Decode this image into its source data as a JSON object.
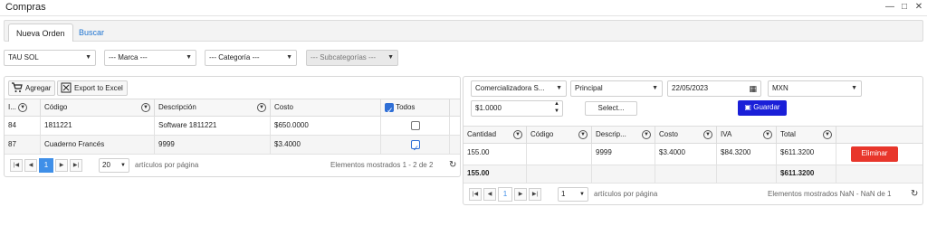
{
  "window": {
    "title": "Compras"
  },
  "tabs": [
    {
      "label": "Nueva Orden",
      "active": true
    },
    {
      "label": "Buscar",
      "active": false
    }
  ],
  "filters": {
    "proveedor": "TAU SOL",
    "marca": "--- Marca ---",
    "categoria": "--- Categoría ---",
    "subcategoria": "--- Subcategorías ---"
  },
  "products_grid": {
    "toolbar": {
      "add_label": "Agregar",
      "export_label": "Export to Excel"
    },
    "columns": [
      "I...",
      "Código",
      "Descripción",
      "Costo",
      "Todos"
    ],
    "rows": [
      {
        "id": "84",
        "codigo": "1811221",
        "descripcion": "Software 1811221",
        "costo": "$650.0000",
        "checked": false
      },
      {
        "id": "87",
        "codigo": "Cuaderno Francés",
        "descripcion": "9999",
        "costo": "$3.4000",
        "checked": true
      }
    ],
    "pager": {
      "page": "1",
      "page_size": "20",
      "page_size_label": "artículos por página",
      "info": "Elementos mostrados 1 - 2 de 2"
    }
  },
  "order": {
    "supplier": "Comercializadora S...",
    "warehouse": "Principal",
    "date": "22/05/2023",
    "currency": "MXN",
    "exchange_rate": "$1.0000",
    "select_label": "Select...",
    "save_label": "Guardar",
    "columns": [
      "Cantidad",
      "Código",
      "Descrip...",
      "Costo",
      "IVA",
      "Total"
    ],
    "rows": [
      {
        "cantidad": "155.00",
        "codigo": "",
        "descripcion": "9999",
        "costo": "$3.4000",
        "iva": "$84.3200",
        "total": "$611.3200",
        "delete_label": "Eliminar"
      }
    ],
    "totals": {
      "cantidad": "155.00",
      "total": "$611.3200"
    },
    "pager": {
      "page": "1",
      "page_size": "1",
      "page_size_label": "artículos por página",
      "info": "Elementos mostrados NaN - NaN de 1"
    }
  },
  "colors": {
    "accent": "#3f8fe8",
    "save": "#1a1fd8",
    "delete": "#e8362b",
    "link": "#1f74d1"
  }
}
